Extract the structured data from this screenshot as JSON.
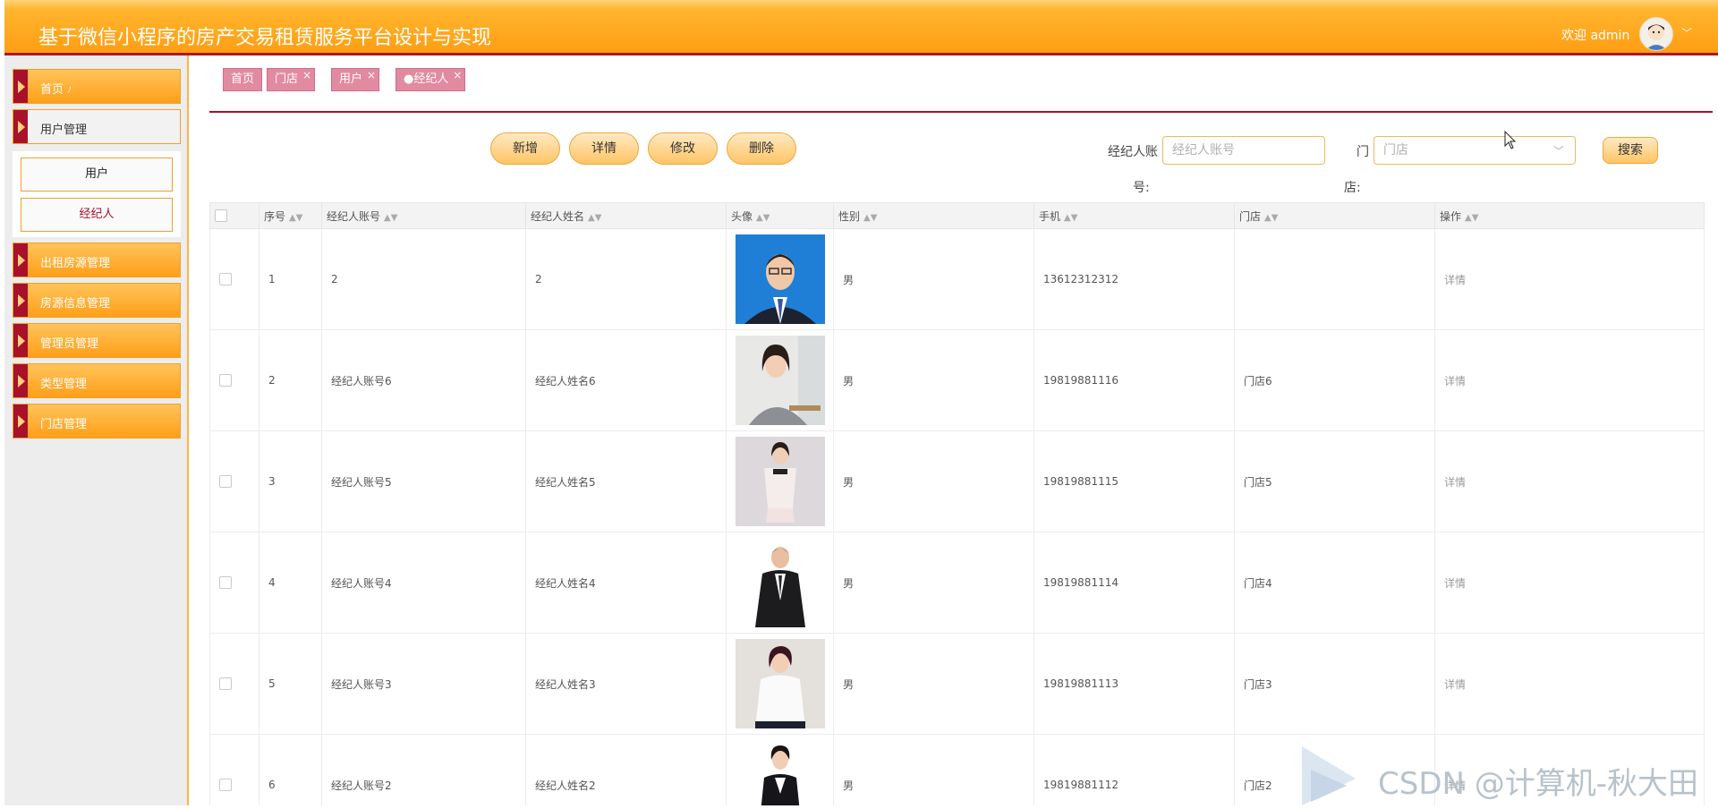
{
  "header": {
    "title": "基于微信小程序的房产交易租赁服务平台设计与实现",
    "welcome": "欢迎 admin"
  },
  "sidebar": {
    "items": [
      {
        "label": "首页",
        "suffix": "ﾉ"
      },
      {
        "label": "用户管理"
      },
      {
        "label": "出租房源管理"
      },
      {
        "label": "房源信息管理"
      },
      {
        "label": "管理员管理"
      },
      {
        "label": "类型管理"
      },
      {
        "label": "门店管理"
      }
    ],
    "submenu": [
      "用户",
      "经纪人"
    ]
  },
  "tabs": [
    {
      "label": "首页"
    },
    {
      "label": "门店"
    },
    {
      "label": "用户"
    },
    {
      "label": "●经纪人"
    }
  ],
  "toolbar": {
    "add": "新增",
    "detail": "详情",
    "edit": "修改",
    "delete": "删除"
  },
  "search": {
    "account_label_line1": "经纪人账",
    "account_label_line2": "号:",
    "account_placeholder": "经纪人账号",
    "store_label_line1": "门",
    "store_label_line2": "店:",
    "store_placeholder": "门店",
    "button": "搜索"
  },
  "table": {
    "headers": [
      "序号",
      "经纪人账号",
      "经纪人姓名",
      "头像",
      "性别",
      "手机",
      "门店",
      "操作"
    ],
    "rows": [
      {
        "no": "1",
        "account": "2",
        "name": "2",
        "gender": "男",
        "phone": "13612312312",
        "store": "",
        "action": "详情"
      },
      {
        "no": "2",
        "account": "经纪人账号6",
        "name": "经纪人姓名6",
        "gender": "男",
        "phone": "19819881116",
        "store": "门店6",
        "action": "详情"
      },
      {
        "no": "3",
        "account": "经纪人账号5",
        "name": "经纪人姓名5",
        "gender": "男",
        "phone": "19819881115",
        "store": "门店5",
        "action": "详情"
      },
      {
        "no": "4",
        "account": "经纪人账号4",
        "name": "经纪人姓名4",
        "gender": "男",
        "phone": "19819881114",
        "store": "门店4",
        "action": "详情"
      },
      {
        "no": "5",
        "account": "经纪人账号3",
        "name": "经纪人姓名3",
        "gender": "男",
        "phone": "19819881113",
        "store": "门店3",
        "action": "详情"
      },
      {
        "no": "6",
        "account": "经纪人账号2",
        "name": "经纪人姓名2",
        "gender": "男",
        "phone": "19819881112",
        "store": "门店2",
        "action": "详情"
      }
    ]
  },
  "watermark": "CSDN @计算机-秋大田"
}
